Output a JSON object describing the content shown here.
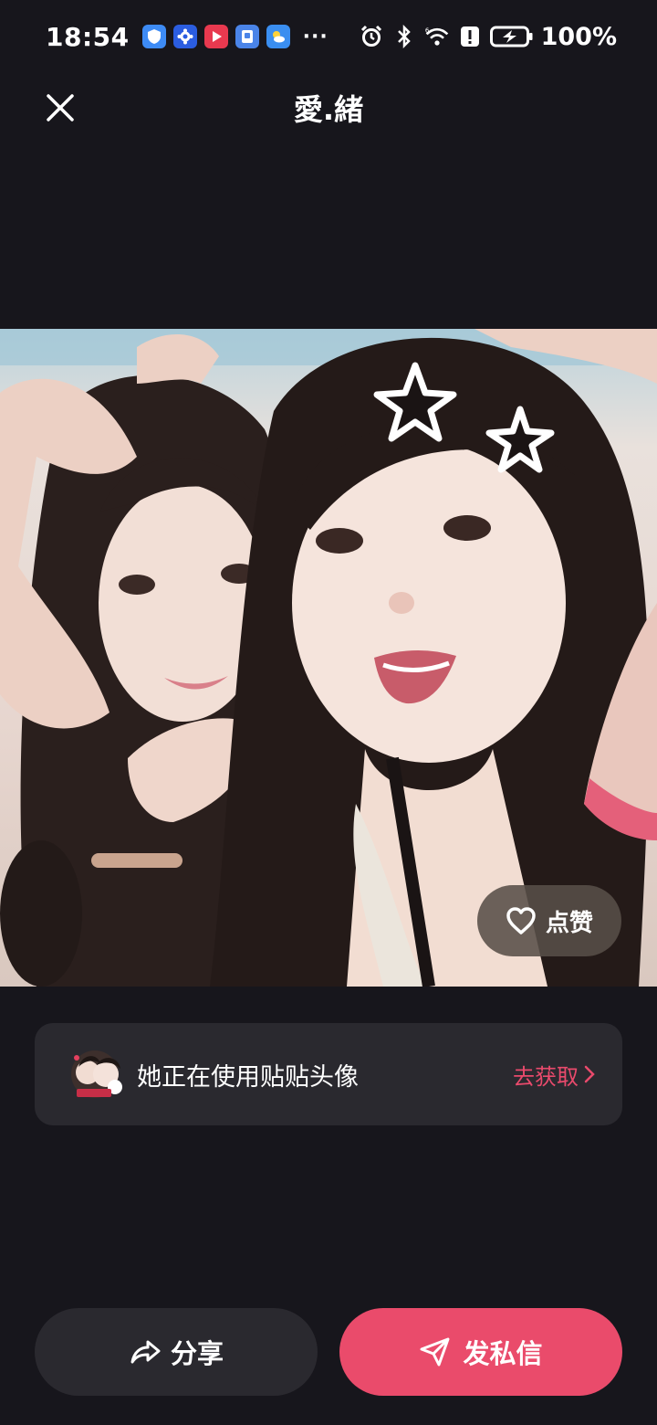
{
  "status_bar": {
    "time": "18:54",
    "battery": "100%",
    "more": "···",
    "app_icons": [
      {
        "name": "shield-app-icon",
        "color": "#3d8bf5",
        "glyph": "◈"
      },
      {
        "name": "gear-app-icon",
        "color": "#2b5de0",
        "glyph": "✿"
      },
      {
        "name": "video-app-icon",
        "color": "#e8394f",
        "glyph": "▶"
      },
      {
        "name": "doc-app-icon",
        "color": "#4a84e8",
        "glyph": "▣"
      },
      {
        "name": "weather-app-icon",
        "color": "#3a8ef0",
        "glyph": "☀"
      }
    ]
  },
  "header": {
    "title": "愛.緒"
  },
  "image": {
    "like_label": "点赞"
  },
  "promo": {
    "text": "她正在使用贴贴头像",
    "action_label": "去获取"
  },
  "actions": {
    "share_label": "分享",
    "message_label": "发私信"
  },
  "colors": {
    "background": "#17161c",
    "card": "#2a292f",
    "accent": "#ea4b6b"
  }
}
